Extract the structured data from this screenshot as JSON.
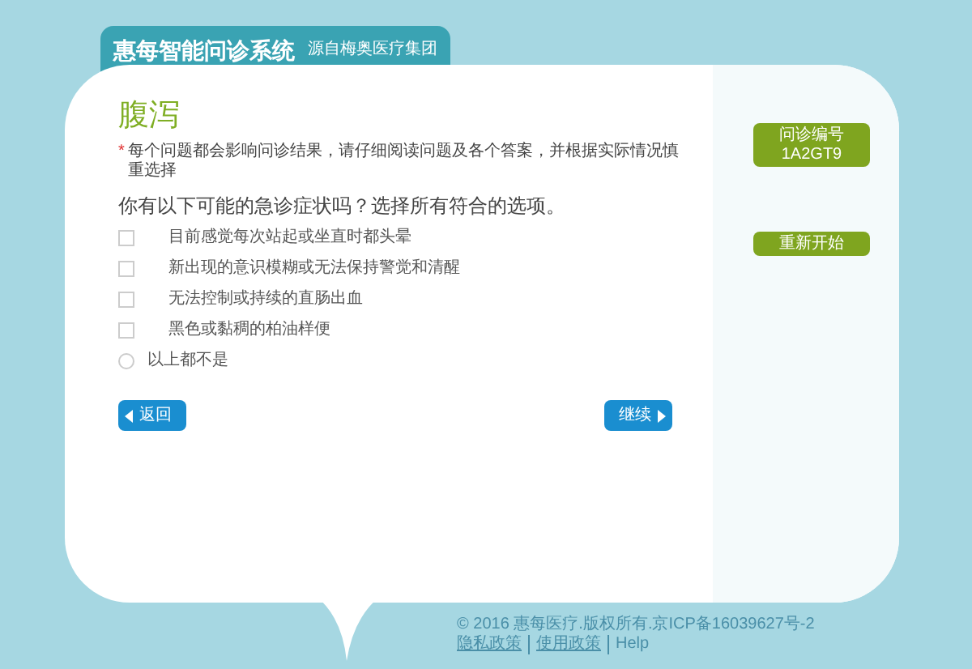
{
  "header": {
    "title": "惠每智能问诊系统",
    "subtitle": "源自梅奥医疗集团"
  },
  "page": {
    "title": "腹泻",
    "required_mark": "*",
    "note": "每个问题都会影响问诊结果，请仔细阅读问题及各个答案，并根据实际情况慎重选择",
    "question": "你有以下可能的急诊症状吗？选择所有符合的选项。"
  },
  "options": [
    {
      "kind": "checkbox",
      "label": "目前感觉每次站起或坐直时都头晕",
      "checked": false
    },
    {
      "kind": "checkbox",
      "label": "新出现的意识模糊或无法保持警觉和清醒",
      "checked": false
    },
    {
      "kind": "checkbox",
      "label": "无法控制或持续的直肠出血",
      "checked": false
    },
    {
      "kind": "checkbox",
      "label": "黑色或黏稠的柏油样便",
      "checked": false
    },
    {
      "kind": "radio",
      "label": "以上都不是",
      "checked": false
    }
  ],
  "buttons": {
    "back": "返回",
    "next": "继续"
  },
  "sidebar": {
    "case_label": "问诊编号",
    "case_number": "1A2GT9",
    "restart": "重新开始"
  },
  "footer": {
    "copyright": "© 2016 惠每医疗.版权所有.京ICP备16039627号-2",
    "links": [
      "隐私政策",
      "使用政策",
      "Help"
    ]
  }
}
